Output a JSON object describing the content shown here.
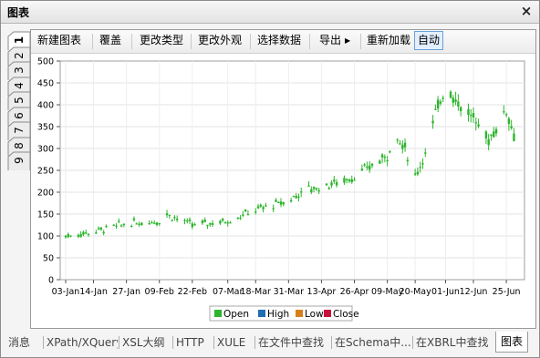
{
  "window": {
    "title": "图表",
    "close_glyph": "×"
  },
  "side_tabs": [
    "1",
    "2",
    "3",
    "4",
    "5",
    "6",
    "7",
    "8",
    "9"
  ],
  "toolbar": {
    "new_chart": "新建图表",
    "overlay": "覆盖",
    "change_type": "更改类型",
    "change_look": "更改外观",
    "select_data": "选择数据",
    "export": "导出",
    "reload": "重新加载",
    "auto": "自动"
  },
  "bottom_tabs": [
    "消息",
    "XPath/XQuery",
    "XSL大纲",
    "HTTP",
    "XULE",
    "在文件中查找",
    "在Schema中...",
    "在XBRL中查找",
    "图表"
  ],
  "colors": {
    "open": "#2db52d",
    "high": "#1f6fb5",
    "low": "#d87f1c",
    "close": "#c8103c"
  },
  "chart_data": {
    "type": "candlestick",
    "ylim": [
      0,
      500
    ],
    "y_ticks": [
      0,
      50,
      100,
      150,
      200,
      250,
      300,
      350,
      400,
      450,
      500
    ],
    "x_ticks": [
      "03-Jan",
      "14-Jan",
      "27-Jan",
      "09-Feb",
      "22-Feb",
      "07-Mar",
      "18-Mar",
      "31-Mar",
      "13-Apr",
      "26-Apr",
      "09-May",
      "20-May",
      "01-Jun",
      "12-Jun",
      "25-Jun"
    ],
    "grid": true,
    "legend_position": "bottom",
    "legend": [
      "Open",
      "High",
      "Low",
      "Close"
    ],
    "series_trend": [
      [
        "03-Jan",
        100
      ],
      [
        "14-Jan",
        110
      ],
      [
        "27-Jan",
        128
      ],
      [
        "09-Feb",
        135
      ],
      [
        "12-Feb",
        150
      ],
      [
        "22-Feb",
        125
      ],
      [
        "07-Mar",
        135
      ],
      [
        "18-Mar",
        160
      ],
      [
        "31-Mar",
        180
      ],
      [
        "06-Apr",
        205
      ],
      [
        "13-Apr",
        212
      ],
      [
        "26-Apr",
        235
      ],
      [
        "09-May",
        285
      ],
      [
        "12-May",
        330
      ],
      [
        "16-May",
        300
      ],
      [
        "20-May",
        235
      ],
      [
        "24-May",
        290
      ],
      [
        "28-May",
        380
      ],
      [
        "01-Jun",
        445
      ],
      [
        "05-Jun",
        410
      ],
      [
        "12-Jun",
        370
      ],
      [
        "18-Jun",
        320
      ],
      [
        "22-Jun",
        355
      ],
      [
        "25-Jun",
        390
      ],
      [
        "30-Jun",
        290
      ]
    ]
  }
}
